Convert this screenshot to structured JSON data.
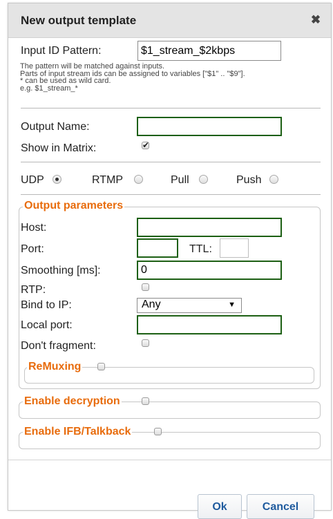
{
  "dialog": {
    "title": "New output template",
    "close_glyph": "✖"
  },
  "input_id": {
    "label": "Input ID Pattern:",
    "value": "$1_stream_$2kbps",
    "help": [
      "The pattern will be matched against inputs.",
      "Parts of input stream ids can be assigned to variables [\"$1\" .. \"$9\"].",
      "* can be used as wild card.",
      "e.g. $1_stream_*"
    ]
  },
  "output_name": {
    "label": "Output Name:",
    "value": ""
  },
  "show_in_matrix": {
    "label": "Show in Matrix:",
    "checked": true
  },
  "protocols": [
    {
      "label": "UDP",
      "selected": true
    },
    {
      "label": "RTMP",
      "selected": false
    },
    {
      "label": "Pull",
      "selected": false
    },
    {
      "label": "Push",
      "selected": false
    }
  ],
  "output_params": {
    "legend": "Output parameters",
    "host_label": "Host:",
    "host_value": "",
    "port_label": "Port:",
    "port_value": "",
    "ttl_label": "TTL:",
    "ttl_value": "",
    "smoothing_label": "Smoothing [ms]:",
    "smoothing_value": "0",
    "rtp_label": "RTP:",
    "bind_label": "Bind to IP:",
    "bind_value": "Any",
    "local_port_label": "Local port:",
    "local_port_value": "",
    "dont_fragment_label": "Don't fragment:",
    "remuxing_legend": "ReMuxing"
  },
  "decryption_legend": "Enable decryption",
  "ifb_legend": "Enable IFB/Talkback",
  "buttons": {
    "ok": "Ok",
    "cancel": "Cancel"
  },
  "colors": {
    "accent_orange": "#e86c0d",
    "field_green": "#1c5f13",
    "button_text": "#1f5b9e"
  }
}
